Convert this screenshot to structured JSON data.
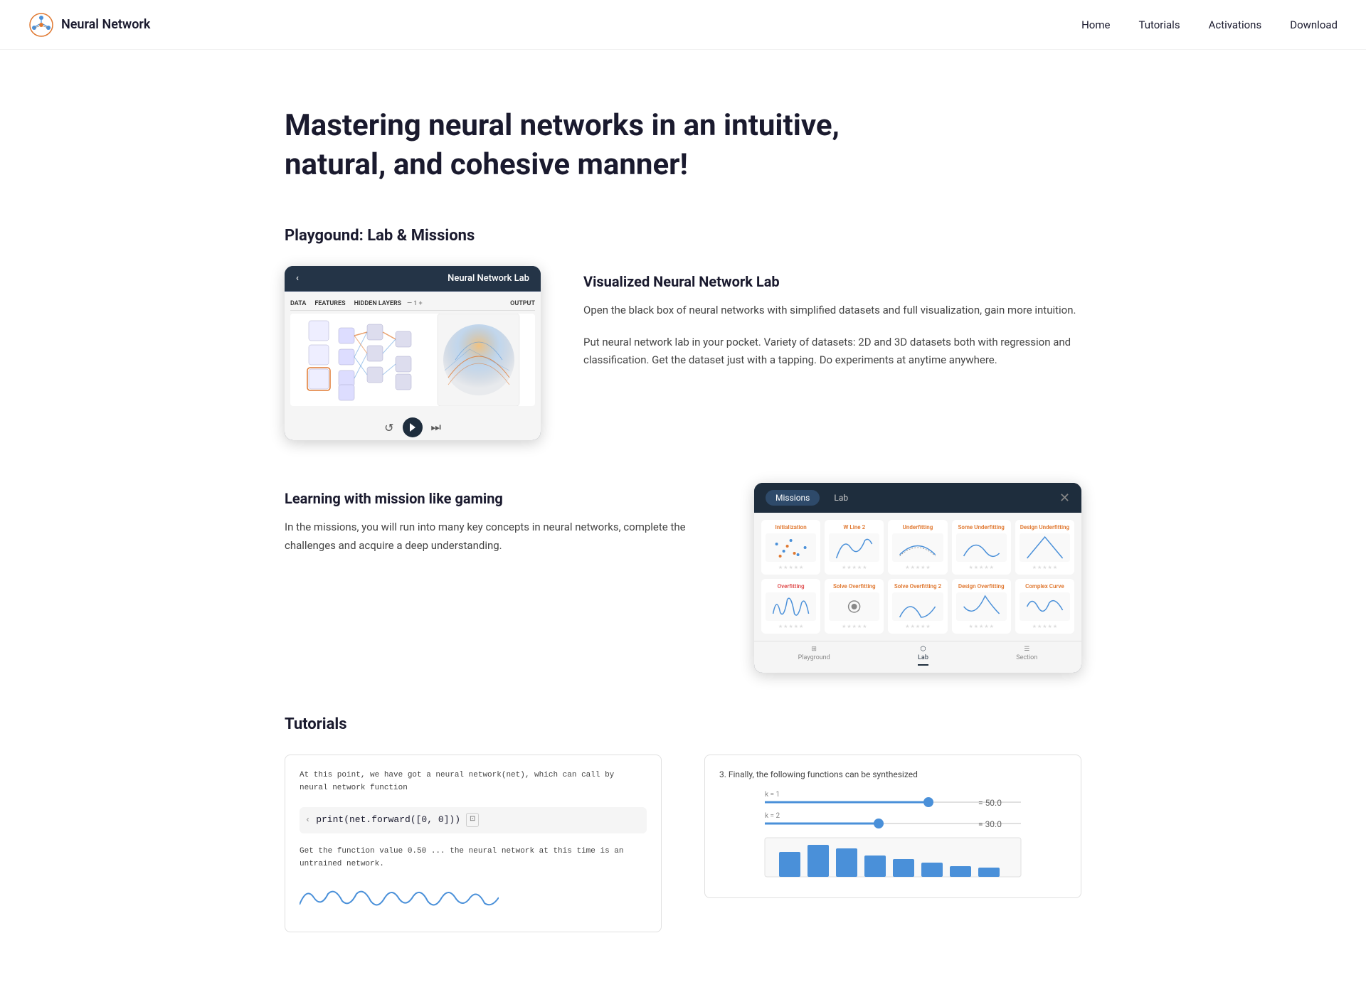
{
  "nav": {
    "brand": "Neural Network",
    "links": [
      "Home",
      "Tutorials",
      "Activations",
      "Download"
    ]
  },
  "hero": {
    "title": "Mastering neural networks in an intuitive, natural, and cohesive manner!"
  },
  "playground": {
    "section_title": "Playgound: Lab & Missions",
    "lab": {
      "title": "Visualized Neural Network Lab",
      "header": "Neural Network Lab",
      "back": "‹",
      "sections": [
        "DATA",
        "FEATURES",
        "HIDDEN LAYERS",
        "— 1  +",
        "OUTPUT"
      ],
      "description1": "Open the black box of neural networks with simplified datasets and full visualization, gain more intuition.",
      "description2": "Put neural network lab in your pocket. Variety of datasets: 2D and 3D datasets both with regression and classification. Get the dataset just with a tapping. Do experiments at anytime anywhere."
    },
    "missions": {
      "title": "Learning with mission like gaming",
      "tab1": "Missions",
      "tab2": "Lab",
      "description": "In the missions, you will run into many key concepts in neural networks, complete the challenges and acquire a deep understanding.",
      "cards": [
        {
          "title": "Initialization",
          "stars": 5
        },
        {
          "title": "W Line 2",
          "stars": 5
        },
        {
          "title": "Underfitting",
          "stars": 5
        },
        {
          "title": "Some Underfitting",
          "stars": 5
        },
        {
          "title": "Design Underfitting",
          "stars": 5
        },
        {
          "title": "Overfitting",
          "stars": 5
        },
        {
          "title": "Solve Overfitting",
          "stars": 5
        },
        {
          "title": "Solve Overfitting 2",
          "stars": 5
        },
        {
          "title": "Design Overfitting",
          "stars": 5
        },
        {
          "title": "Complex Curve",
          "stars": 5
        }
      ],
      "nav_items": [
        "Playground",
        "Lab",
        "Section"
      ]
    }
  },
  "tutorials": {
    "section_title": "Tutorials",
    "preview_text1": "At this point, we have got a neural network(net), which can call by neural network function",
    "preview_code": "print(net.forward([0, 0]))",
    "preview_text2": "Get the function value 0.50 ... the neural network at this time is an untrained network.",
    "chart_label": "3. Finally, the following functions can be synthesized"
  }
}
